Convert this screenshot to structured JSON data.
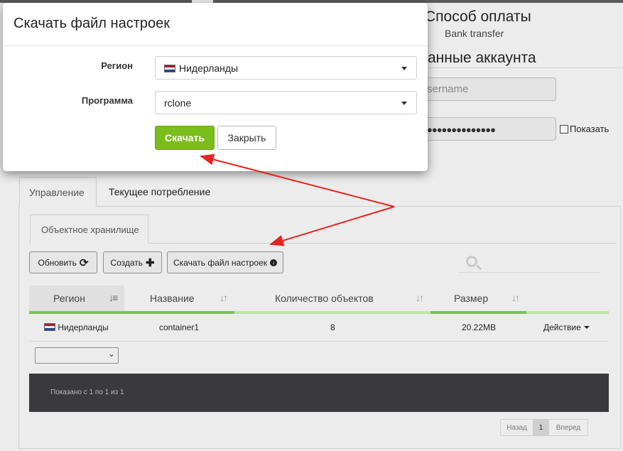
{
  "modal": {
    "title": "Скачать файл настроек",
    "region_label": "Регион",
    "region_value": "Нидерланды",
    "program_label": "Программа",
    "program_value": "rclone",
    "download_button": "Скачать",
    "close_button": "Закрыть"
  },
  "account": {
    "payment_title": "Способ оплаты",
    "payment_value": "Bank transfer",
    "data_title": "анные аккаунта",
    "username_placeholder": "sername",
    "password_mask": "●●●●●●●●●●●●●●",
    "show_password_label": "Показать"
  },
  "tabs": {
    "manage": "Управление",
    "usage": "Текущее потребление",
    "object_storage": "Объектное хранилище"
  },
  "toolbar": {
    "refresh": "Обновить",
    "create": "Создать",
    "download_config": "Скачать файл настроек"
  },
  "table": {
    "headers": [
      "Регион",
      "Название",
      "Количество объектов",
      "Размер"
    ],
    "rows": [
      {
        "region": "Нидерланды",
        "name": "container1",
        "objects": "8",
        "size": "20.22MB",
        "action": "Действие"
      }
    ],
    "info": "Показано с 1 по 1 из 1"
  },
  "pager": {
    "prev": "Назад",
    "page": "1",
    "next": "Вперед"
  },
  "colors": {
    "accent_green": "#7cbd1e",
    "arrow_red": "#e8231f"
  }
}
